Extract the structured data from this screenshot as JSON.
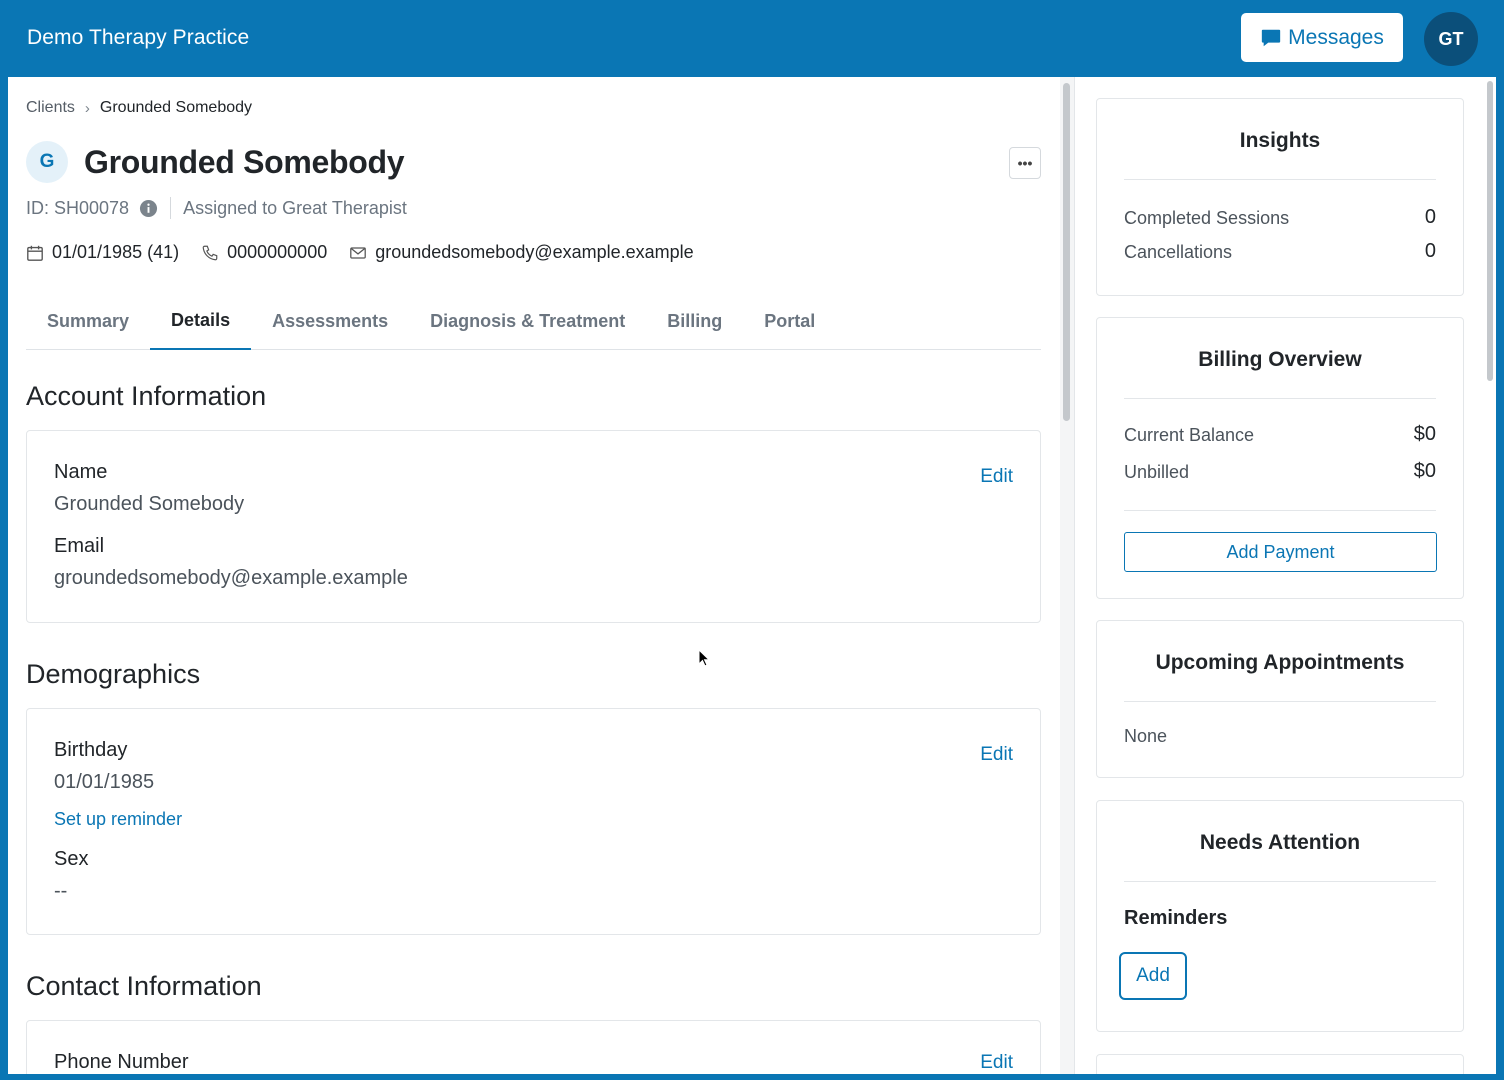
{
  "app": {
    "title": "Demo Therapy Practice"
  },
  "header": {
    "messages_label": "Messages",
    "user_initials": "GT"
  },
  "breadcrumb": {
    "parent": "Clients",
    "current": "Grounded Somebody"
  },
  "client": {
    "initial": "G",
    "name": "Grounded Somebody",
    "id_text": "ID: SH00078",
    "assigned_text": "Assigned to Great Therapist",
    "birthdate_age": "01/01/1985 (41)",
    "phone": "0000000000",
    "email": "groundedsomebody@example.example"
  },
  "tabs": [
    {
      "label": "Summary",
      "active": false
    },
    {
      "label": "Details",
      "active": true
    },
    {
      "label": "Assessments",
      "active": false
    },
    {
      "label": "Diagnosis & Treatment",
      "active": false
    },
    {
      "label": "Billing",
      "active": false
    },
    {
      "label": "Portal",
      "active": false
    }
  ],
  "account": {
    "title": "Account Information",
    "edit_label": "Edit",
    "name_label": "Name",
    "name_value": "Grounded Somebody",
    "email_label": "Email",
    "email_value": "groundedsomebody@example.example"
  },
  "demographics": {
    "title": "Demographics",
    "edit_label": "Edit",
    "birthday_label": "Birthday",
    "birthday_value": "01/01/1985",
    "reminder_link": "Set up reminder",
    "sex_label": "Sex",
    "sex_value": "--"
  },
  "contact": {
    "title": "Contact Information",
    "edit_label": "Edit",
    "phone_label": "Phone Number"
  },
  "insights": {
    "title": "Insights",
    "completed_label": "Completed Sessions",
    "completed_value": "0",
    "cancellations_label": "Cancellations",
    "cancellations_value": "0"
  },
  "billing_overview": {
    "title": "Billing Overview",
    "balance_label": "Current Balance",
    "balance_value": "$0",
    "unbilled_label": "Unbilled",
    "unbilled_value": "$0",
    "add_payment_label": "Add Payment"
  },
  "upcoming": {
    "title": "Upcoming Appointments",
    "none_text": "None"
  },
  "attention": {
    "title": "Needs Attention",
    "reminders_label": "Reminders",
    "add_label": "Add"
  },
  "colors": {
    "brand": "#0a76b4",
    "avatar_dark": "#0b4f7a"
  }
}
